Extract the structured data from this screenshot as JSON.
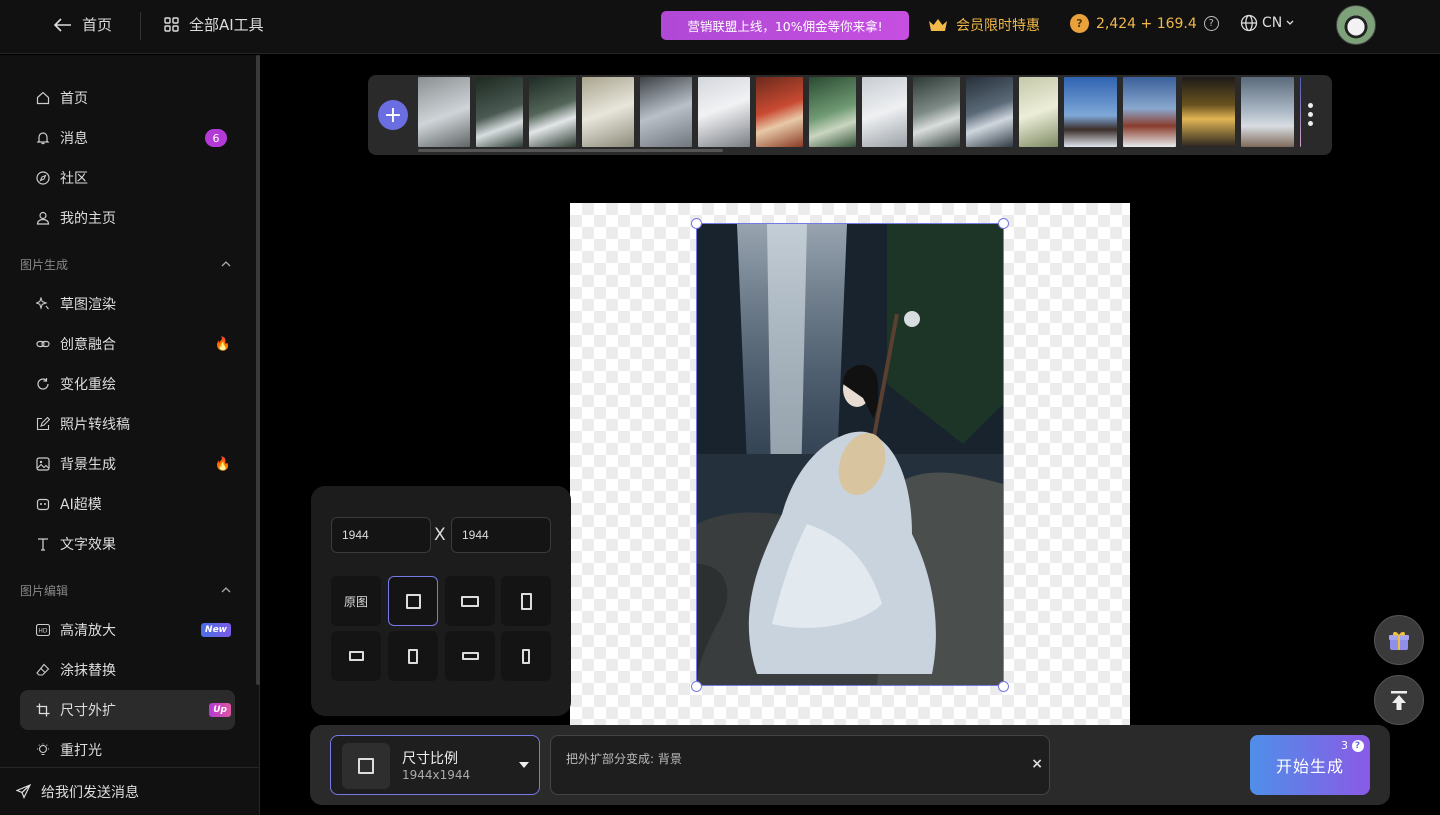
{
  "header": {
    "home_label": "首页",
    "all_tools_label": "全部AI工具",
    "promo_text": "营销联盟上线，10%佣金等你来拿!",
    "vip_label": "会员限时特惠",
    "credits_text": "2,424 + 169.4",
    "lang_label": "CN"
  },
  "sidebar": {
    "top_items": [
      {
        "label": "首页",
        "icon": "home-icon"
      },
      {
        "label": "消息",
        "icon": "bell-icon",
        "badge": "6"
      },
      {
        "label": "社区",
        "icon": "compass-icon"
      },
      {
        "label": "我的主页",
        "icon": "user-icon"
      }
    ],
    "section_generate": "图片生成",
    "generate_items": [
      {
        "label": "草图渲染",
        "icon": "sparkle-icon"
      },
      {
        "label": "创意融合",
        "icon": "link-icon",
        "hot": true
      },
      {
        "label": "变化重绘",
        "icon": "refresh-icon"
      },
      {
        "label": "照片转线稿",
        "icon": "edit-square-icon"
      },
      {
        "label": "背景生成",
        "icon": "image-icon",
        "hot": true
      },
      {
        "label": "AI超模",
        "icon": "robot-icon"
      },
      {
        "label": "文字效果",
        "icon": "text-icon"
      }
    ],
    "section_edit": "图片编辑",
    "edit_items": [
      {
        "label": "高清放大",
        "icon": "hd-icon",
        "tag": "New"
      },
      {
        "label": "涂抹替换",
        "icon": "eraser-icon"
      },
      {
        "label": "尺寸外扩",
        "icon": "crop-icon",
        "tag": "Up",
        "active": true
      },
      {
        "label": "重打光",
        "icon": "bulb-icon"
      }
    ],
    "feedback_label": "给我们发送消息"
  },
  "size_panel": {
    "width_value": "1944",
    "height_value": "1944",
    "x_label": "X",
    "original_label": "原图"
  },
  "bottom": {
    "ratio_title": "尺寸比例",
    "ratio_value": "1944x1944",
    "prompt_text": "把外扩部分变成: 背景",
    "generate_label": "开始生成",
    "generate_count": "3"
  },
  "colors": {
    "accent": "#7779e6",
    "promo": "#b049d6",
    "gold": "#f1b84a"
  }
}
